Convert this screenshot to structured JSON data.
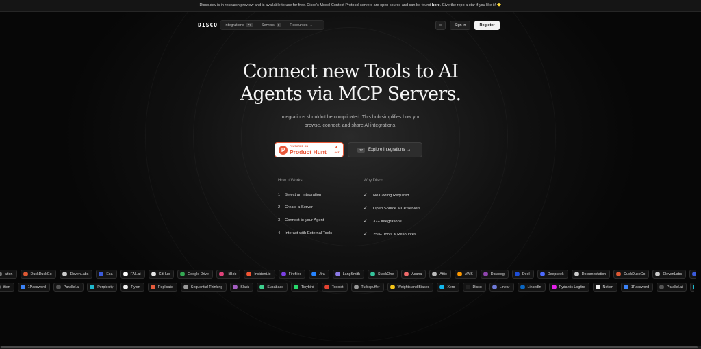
{
  "announcement": {
    "text_before": "Disco.dev is in research preview and is available to use for free. Disco's Model Context Protocol servers are open source and can be found ",
    "link": "here",
    "text_after": ". Give the repo a star if you like it! ⭐"
  },
  "nav": {
    "logo": "DISCO",
    "integrations_label": "Integrations",
    "integrations_count": "77",
    "servers_label": "Servers",
    "servers_count": "0",
    "resources_label": "Resources",
    "theme_icon": "monitor-icon",
    "signin": "Sign in",
    "register": "Register"
  },
  "hero": {
    "title_line1": "Connect new Tools to AI",
    "title_line2": "Agents via MCP Servers.",
    "subtitle_line1": "Integrations shouldn't be complicated. This hub simplifies how you",
    "subtitle_line2": "browse, connect, and share AI integrations."
  },
  "product_hunt": {
    "small": "FEATURED ON",
    "name": "Product Hunt",
    "upvotes": "137",
    "accent": "#e8573a"
  },
  "explore": {
    "kbd": "77",
    "label": "Explore Integrations",
    "arrow": "→"
  },
  "how_it_works": {
    "heading": "How It Works",
    "steps": [
      {
        "num": "1",
        "text": "Select an Integration"
      },
      {
        "num": "2",
        "text": "Create a Server"
      },
      {
        "num": "3",
        "text": "Connect to your Agent"
      },
      {
        "num": "4",
        "text": "Interact with External Tools"
      }
    ]
  },
  "why_disco": {
    "heading": "Why Disco",
    "items": [
      "No Coding Required",
      "Open Source MCP servers",
      "37+ Integrations",
      "250+ Tools & Resources"
    ]
  },
  "marquee_row1": [
    {
      "label": "ation",
      "color": "#777777"
    },
    {
      "label": "DuckDuckGo",
      "color": "#de5833"
    },
    {
      "label": "ElevenLabs",
      "color": "#cccccc"
    },
    {
      "label": "Exa",
      "color": "#3b5bdb"
    },
    {
      "label": "FAL.ai",
      "color": "#ffffff"
    },
    {
      "label": "GitHub",
      "color": "#e6e6e6"
    },
    {
      "label": "Google Drive",
      "color": "#34a853"
    },
    {
      "label": "HiBob",
      "color": "#e0437a"
    },
    {
      "label": "Incident.io",
      "color": "#f25533"
    },
    {
      "label": "Fireflies",
      "color": "#7b3fe4"
    },
    {
      "label": "Jira",
      "color": "#2684ff"
    },
    {
      "label": "LangSmith",
      "color": "#8c7ae6"
    },
    {
      "label": "StackOne",
      "color": "#35c39b"
    },
    {
      "label": "Asana",
      "color": "#f06a6a"
    },
    {
      "label": "Attio",
      "color": "#bbbbbb"
    },
    {
      "label": "AWS",
      "color": "#ff9900"
    },
    {
      "label": "Datadog",
      "color": "#8e44ad"
    },
    {
      "label": "Deel",
      "color": "#1d4ed8"
    },
    {
      "label": "Deepseek",
      "color": "#4d6bfe"
    },
    {
      "label": "Documentation",
      "color": "#cccccc"
    },
    {
      "label": "DuckDuckGo",
      "color": "#de5833"
    },
    {
      "label": "ElevenLabs",
      "color": "#cccccc"
    },
    {
      "label": "Ex",
      "color": "#3b5bdb"
    }
  ],
  "marquee_row2": [
    {
      "label": "ition",
      "color": "#777777"
    },
    {
      "label": "1Password",
      "color": "#3b82f6"
    },
    {
      "label": "Parallel.ai",
      "color": "#555555"
    },
    {
      "label": "Perplexity",
      "color": "#20b8cd"
    },
    {
      "label": "Pylon",
      "color": "#eeeeee"
    },
    {
      "label": "Replicate",
      "color": "#e55b3c"
    },
    {
      "label": "Sequential Thinking",
      "color": "#999999"
    },
    {
      "label": "Slack",
      "color": "#a45ec2"
    },
    {
      "label": "Supabase",
      "color": "#3ecf8e"
    },
    {
      "label": "Tinybird",
      "color": "#27d86b"
    },
    {
      "label": "Todoist",
      "color": "#e44332"
    },
    {
      "label": "Turbopuffer",
      "color": "#999999"
    },
    {
      "label": "Weights and Biases",
      "color": "#f5c518"
    },
    {
      "label": "Xero",
      "color": "#13b5ea"
    },
    {
      "label": "Disco",
      "color": "#222222"
    },
    {
      "label": "Linear",
      "color": "#6e79d6"
    },
    {
      "label": "LinkedIn",
      "color": "#0a66c2"
    },
    {
      "label": "Pydantic Logfire",
      "color": "#e520e9"
    },
    {
      "label": "Notion",
      "color": "#eeeeee"
    },
    {
      "label": "1Password",
      "color": "#3b82f6"
    },
    {
      "label": "Parallel.ai",
      "color": "#555555"
    },
    {
      "label": "",
      "color": "#20b8cd"
    }
  ]
}
